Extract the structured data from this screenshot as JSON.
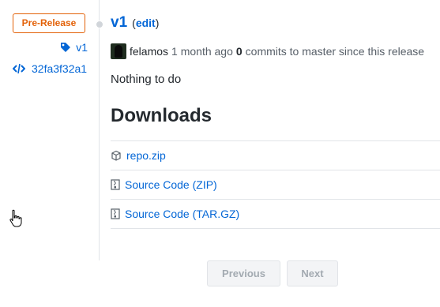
{
  "sidebar": {
    "badge": "Pre-Release",
    "tag": "v1",
    "commit": "32fa3f32a1"
  },
  "release": {
    "title": "v1",
    "edit_open": "(",
    "edit_label": "edit",
    "edit_close": ")",
    "author": "felamos",
    "time": "1 month ago",
    "commits_count": "0",
    "commits_text": "commits to master since this release",
    "body": "Nothing to do"
  },
  "downloads": {
    "heading": "Downloads",
    "items": [
      {
        "label": "repo.zip",
        "icon": "package-icon"
      },
      {
        "label": "Source Code (ZIP)",
        "icon": "file-zip-icon"
      },
      {
        "label": "Source Code (TAR.GZ)",
        "icon": "file-zip-icon"
      }
    ]
  },
  "pagination": {
    "previous": "Previous",
    "next": "Next"
  },
  "colors": {
    "link": "#0366d6",
    "prerelease": "#e36209"
  }
}
